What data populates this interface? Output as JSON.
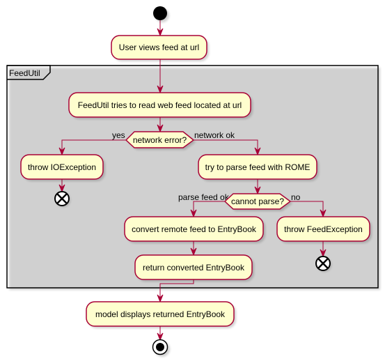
{
  "diagram": {
    "type": "uml-activity",
    "colors": {
      "activity_fill": "#FEFECE",
      "activity_border": "#A80036",
      "edge": "#A80036",
      "start_node": "#000000",
      "frame": "#000000"
    },
    "frame": {
      "label": "FeedUtil"
    },
    "nodes": {
      "start": {
        "kind": "start"
      },
      "user_views": {
        "kind": "activity",
        "label": "User views feed at url"
      },
      "try_read": {
        "kind": "activity",
        "label": "FeedUtil tries to read web feed located at url"
      },
      "network_error": {
        "kind": "decision",
        "label": "network error?"
      },
      "throw_io": {
        "kind": "activity",
        "label": "throw IOException"
      },
      "end_io": {
        "kind": "end"
      },
      "try_parse": {
        "kind": "activity",
        "label": "try to parse feed with ROME"
      },
      "cannot_parse": {
        "kind": "decision",
        "label": "cannot parse?"
      },
      "convert": {
        "kind": "activity",
        "label": "convert remote feed to EntryBook"
      },
      "throw_feed": {
        "kind": "activity",
        "label": "throw FeedException"
      },
      "end_feed": {
        "kind": "end"
      },
      "return_book": {
        "kind": "activity",
        "label": "return converted EntryBook"
      },
      "model_displays": {
        "kind": "activity",
        "label": "model displays returned EntryBook"
      },
      "stop": {
        "kind": "stop"
      }
    },
    "edge_labels": {
      "network_yes": "yes",
      "network_ok": "network ok",
      "parse_ok": "parse feed ok",
      "parse_no": "no"
    },
    "edges": [
      {
        "from": "start",
        "to": "user_views"
      },
      {
        "from": "user_views",
        "to": "try_read"
      },
      {
        "from": "try_read",
        "to": "network_error"
      },
      {
        "from": "network_error",
        "to": "throw_io",
        "label": "yes"
      },
      {
        "from": "throw_io",
        "to": "end_io"
      },
      {
        "from": "network_error",
        "to": "try_parse",
        "label": "network ok"
      },
      {
        "from": "try_parse",
        "to": "cannot_parse"
      },
      {
        "from": "cannot_parse",
        "to": "convert",
        "label": "parse feed ok"
      },
      {
        "from": "cannot_parse",
        "to": "throw_feed",
        "label": "no"
      },
      {
        "from": "throw_feed",
        "to": "end_feed"
      },
      {
        "from": "convert",
        "to": "return_book"
      },
      {
        "from": "return_book",
        "to": "model_displays"
      },
      {
        "from": "model_displays",
        "to": "stop"
      }
    ]
  }
}
